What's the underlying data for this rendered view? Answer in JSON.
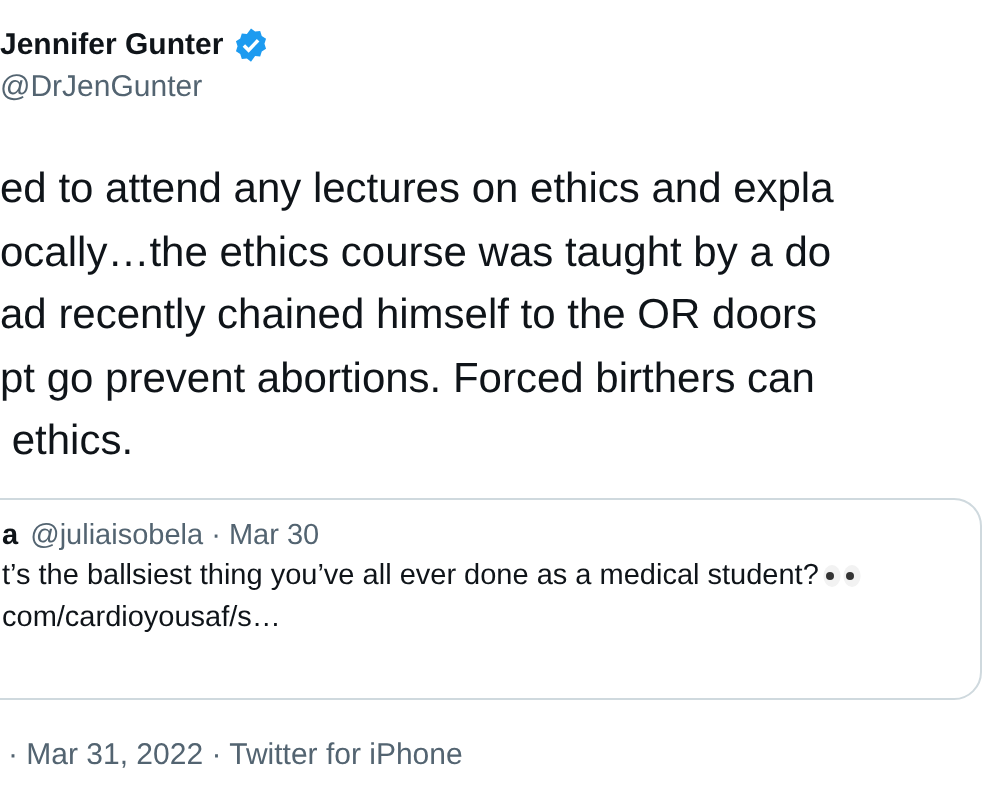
{
  "author": {
    "name": "Jennifer Gunter",
    "verified": true,
    "handle": "@DrJenGunter"
  },
  "tweet_lines": [
    "ed to attend any lectures on ethics and expla",
    "ocally…the ethics course was taught by a do",
    "ad recently chained himself to the OR doors",
    "pt go prevent abortions. Forced birthers can",
    " ethics."
  ],
  "quoted_tweet": {
    "name": "a",
    "handle": "@juliaisobela · Mar 30",
    "lines": [
      "t’s the ballsiest thing you’ve all ever done as a medical student?",
      "com/cardioyousaf/s…"
    ]
  },
  "footer": "· Mar 31, 2022 · Twitter for iPhone"
}
